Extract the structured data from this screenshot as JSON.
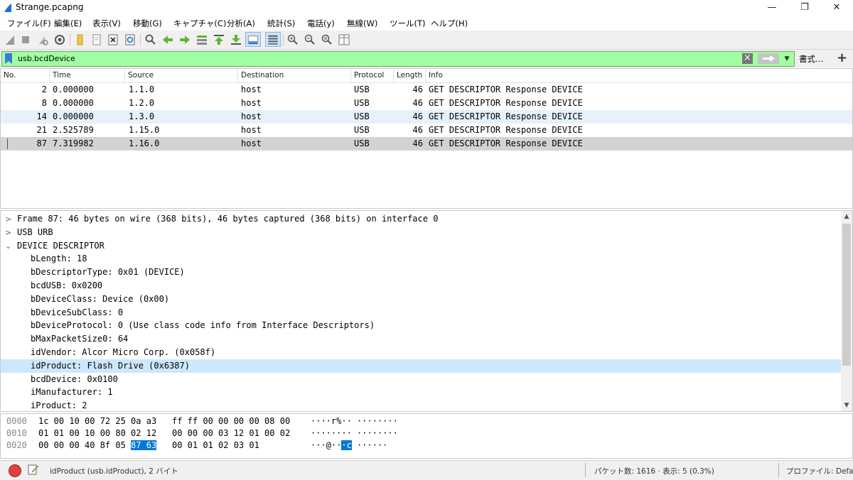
{
  "window": {
    "title": "Strange.pcapng",
    "controls": [
      "—",
      "❐",
      "✕"
    ]
  },
  "menu": [
    "ファイル(F)",
    "編集(E)",
    "表示(V)",
    "移動(G)",
    "キャプチャ(C)",
    "分析(A)",
    "統計(S)",
    "電話(y)",
    "無線(W)",
    "ツール(T)",
    "ヘルプ(H)"
  ],
  "filter": {
    "value": "usb.bcdDevice",
    "format_label": "書式…",
    "add_label": "+"
  },
  "packet_list": {
    "columns": [
      "No.",
      "Time",
      "Source",
      "Destination",
      "Protocol",
      "Length",
      "Info"
    ],
    "rows": [
      {
        "no": "2",
        "time": "0.000000",
        "source": "1.1.0",
        "destination": "host",
        "protocol": "USB",
        "length": "46",
        "info": "GET DESCRIPTOR Response DEVICE"
      },
      {
        "no": "8",
        "time": "0.000000",
        "source": "1.2.0",
        "destination": "host",
        "protocol": "USB",
        "length": "46",
        "info": "GET DESCRIPTOR Response DEVICE"
      },
      {
        "no": "14",
        "time": "0.000000",
        "source": "1.3.0",
        "destination": "host",
        "protocol": "USB",
        "length": "46",
        "info": "GET DESCRIPTOR Response DEVICE"
      },
      {
        "no": "21",
        "time": "2.525789",
        "source": "1.15.0",
        "destination": "host",
        "protocol": "USB",
        "length": "46",
        "info": "GET DESCRIPTOR Response DEVICE"
      },
      {
        "no": "87",
        "time": "7.319982",
        "source": "1.16.0",
        "destination": "host",
        "protocol": "USB",
        "length": "46",
        "info": "GET DESCRIPTOR Response DEVICE"
      }
    ]
  },
  "details": {
    "tree": [
      {
        "arrow": ">",
        "text": "Frame 87: 46 bytes on wire (368 bits), 46 bytes captured (368 bits) on interface 0"
      },
      {
        "arrow": ">",
        "text": "USB URB"
      },
      {
        "arrow": "⌄",
        "text": "DEVICE DESCRIPTOR"
      },
      {
        "arrow": "",
        "text": "bLength: 18"
      },
      {
        "arrow": "",
        "text": "bDescriptorType: 0x01 (DEVICE)"
      },
      {
        "arrow": "",
        "text": "bcdUSB: 0x0200"
      },
      {
        "arrow": "",
        "text": "bDeviceClass: Device (0x00)"
      },
      {
        "arrow": "",
        "text": "bDeviceSubClass: 0"
      },
      {
        "arrow": "",
        "text": "bDeviceProtocol: 0 (Use class code info from Interface Descriptors)"
      },
      {
        "arrow": "",
        "text": "bMaxPacketSize0: 64"
      },
      {
        "arrow": "",
        "text": "idVendor: Alcor Micro Corp. (0x058f)"
      },
      {
        "arrow": "",
        "text": "idProduct: Flash Drive (0x6387)"
      },
      {
        "arrow": "",
        "text": "bcdDevice: 0x0100"
      },
      {
        "arrow": "",
        "text": "iManufacturer: 1"
      },
      {
        "arrow": "",
        "text": "iProduct: 2"
      }
    ]
  },
  "bytes": {
    "rows": [
      {
        "offset": "0000",
        "hex_a": "1c 00 10 00 72 25 0a a3",
        "hex_b": "ff ff 00 00 00 00 08 00",
        "ascii": "····r%·· ········"
      },
      {
        "offset": "0010",
        "hex_a": "01 01 00 10 00 80 02 12",
        "hex_b": "00 00 00 03 12 01 00 02",
        "ascii": "········ ········"
      },
      {
        "offset": "0020",
        "hex_a_pre": "00 00 00 40 8f 05 ",
        "hex_a_sel": "87 63",
        "hex_b": "00 01 01 02 03 01",
        "ascii_pre": "···@··",
        "ascii_sel": "·c",
        "ascii_post": " ······"
      }
    ]
  },
  "status": {
    "field_info": "idProduct (usb.idProduct), 2 バイト",
    "packets": "パケット数: 1616 · 表示: 5 (0.3%)",
    "profile": "プロファイル: Default"
  }
}
